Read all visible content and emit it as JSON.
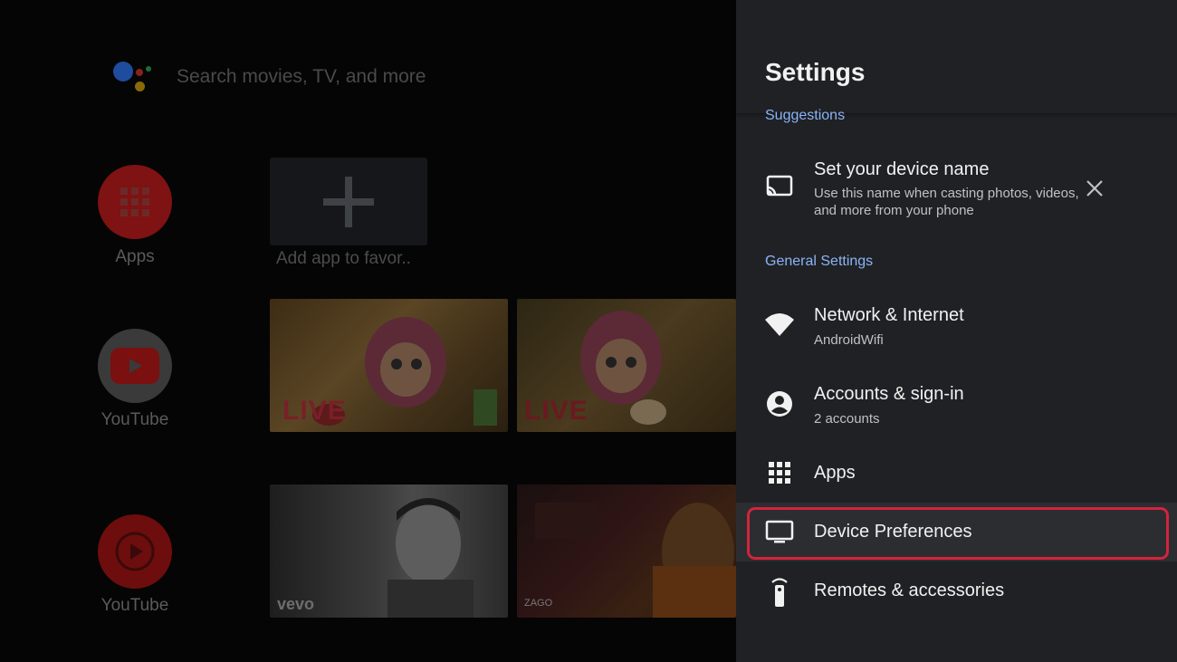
{
  "home": {
    "search_placeholder": "Search movies, TV, and more",
    "rows": [
      {
        "label": "Apps",
        "icon": "apps-grid-icon"
      },
      {
        "label": "YouTube",
        "icon": "youtube-icon"
      },
      {
        "label": "YouTube",
        "icon": "youtube-music-icon"
      }
    ],
    "favorite_tile_label": "Add app to favor..",
    "thumbnails": {
      "row1": [
        "LIVE",
        "LIVE"
      ],
      "row2_watermark": "vevo",
      "row2_logo": "ZAGO"
    },
    "colors": {
      "assistant_blue": "#4285f4",
      "assistant_red": "#ea4335",
      "assistant_yellow": "#fbbc05",
      "assistant_green": "#34a853",
      "apps_red": "#8e1414"
    }
  },
  "settings": {
    "title": "Settings",
    "sections": {
      "suggestions": "Suggestions",
      "general": "General Settings"
    },
    "suggestion_item": {
      "title": "Set your device name",
      "subtitle_line1": "Use this name when casting photos, videos,",
      "subtitle_line2": "and more from your phone",
      "icon": "cast-icon",
      "dismiss_icon": "close-icon"
    },
    "items": [
      {
        "title": "Network & Internet",
        "subtitle": "AndroidWifi",
        "icon": "wifi-icon"
      },
      {
        "title": "Accounts & sign-in",
        "subtitle": "2 accounts",
        "icon": "account-circle-icon"
      },
      {
        "title": "Apps",
        "icon": "apps-grid-icon"
      },
      {
        "title": "Device Preferences",
        "icon": "tv-icon",
        "selected": true
      },
      {
        "title": "Remotes & accessories",
        "icon": "remote-icon"
      }
    ],
    "colors": {
      "panel_bg": "#202124",
      "section_text": "#8ab4f8",
      "focus_ring": "#d3233d"
    }
  }
}
